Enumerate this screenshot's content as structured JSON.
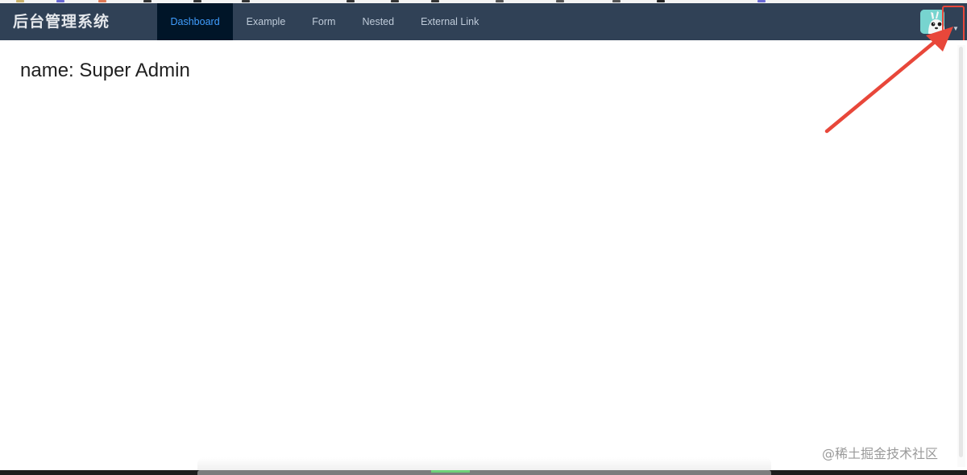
{
  "navbar": {
    "brand": "后台管理系统",
    "menu": [
      {
        "label": "Dashboard",
        "active": true
      },
      {
        "label": "Example",
        "active": false
      },
      {
        "label": "Form",
        "active": false
      },
      {
        "label": "Nested",
        "active": false
      },
      {
        "label": "External Link",
        "active": false
      }
    ],
    "avatar_icon": "user-avatar-icon",
    "dropdown_icon": "caret-down-icon"
  },
  "main": {
    "welcome_text": "name: Super Admin"
  },
  "annotation": {
    "arrow_color": "#e8473a",
    "highlight_target": "avatar dropdown"
  },
  "watermark": "@稀土掘金技术社区",
  "colors": {
    "navbar_bg": "#304156",
    "menu_active_bg": "#001528",
    "menu_active_text": "#409eff",
    "menu_text": "#bfcbd9",
    "accent_red": "#e8473a"
  }
}
